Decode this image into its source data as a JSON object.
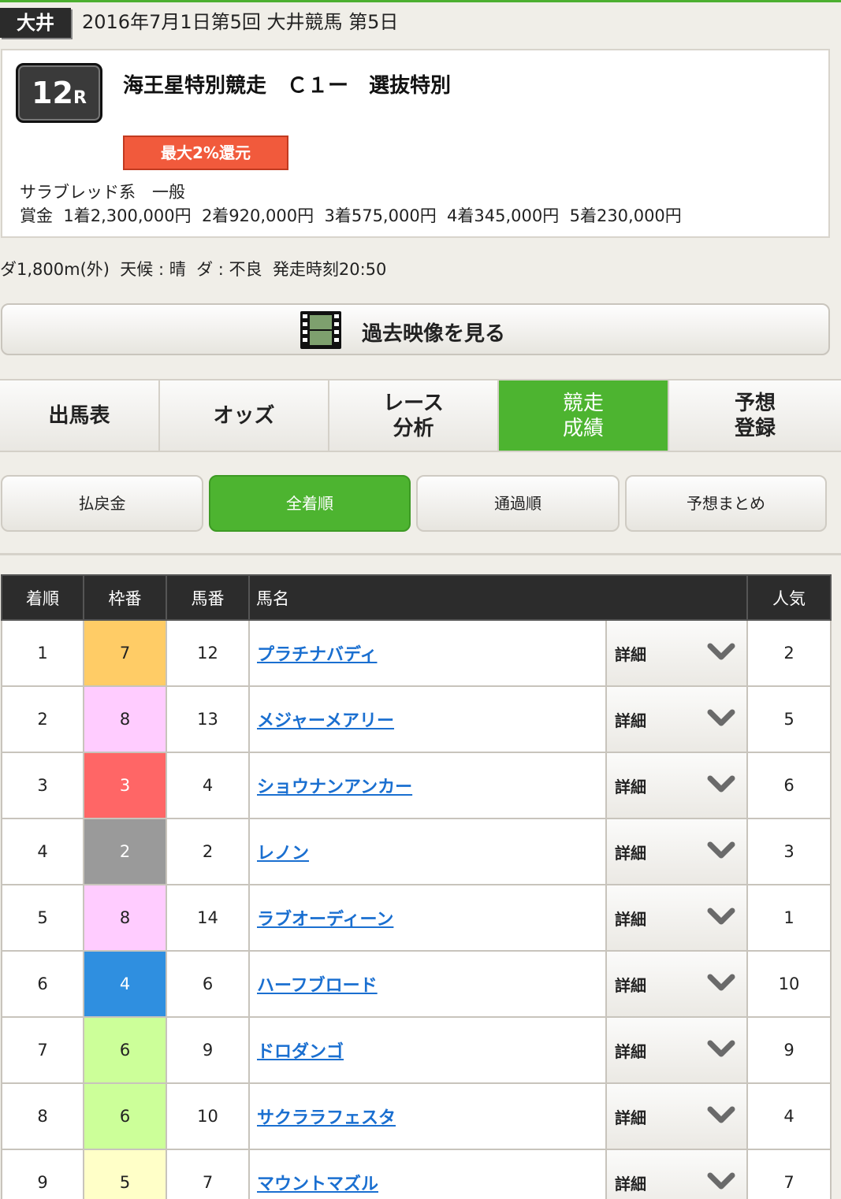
{
  "header": {
    "venue": "大井",
    "meeting": "2016年7月1日第5回 大井競馬 第5日"
  },
  "race": {
    "number": "12",
    "suffix": "R",
    "title": "海王星特別競走　Ｃ１ー　選抜特別",
    "rebate": "最大2%還元",
    "breed": "サラブレッド系　一般",
    "prize": "賞金  1着2,300,000円  2着920,000円  3着575,000円  4着345,000円  5着230,000円"
  },
  "conditions": "ダ1,800m(外)  天候 : 晴  ダ : 不良  発走時刻20:50",
  "video_button": "過去映像を見る",
  "tabs": [
    {
      "line1": "出馬表",
      "line2": ""
    },
    {
      "line1": "オッズ",
      "line2": ""
    },
    {
      "line1": "レース",
      "line2": "分析"
    },
    {
      "line1": "競走",
      "line2": "成績"
    },
    {
      "line1": "予想",
      "line2": "登録"
    }
  ],
  "subtabs": [
    "払戻金",
    "全着順",
    "通過順",
    "予想まとめ"
  ],
  "table": {
    "headers": {
      "rank": "着順",
      "frame": "枠番",
      "horse_no": "馬番",
      "name": "馬名",
      "popularity": "人気"
    },
    "detail_label": "詳細",
    "rows": [
      {
        "rank": "1",
        "frame": "7",
        "horse_no": "12",
        "name": "プラチナバディ",
        "popularity": "2"
      },
      {
        "rank": "2",
        "frame": "8",
        "horse_no": "13",
        "name": "メジャーメアリー",
        "popularity": "5"
      },
      {
        "rank": "3",
        "frame": "3",
        "horse_no": "4",
        "name": "ショウナンアンカー",
        "popularity": "6"
      },
      {
        "rank": "4",
        "frame": "2",
        "horse_no": "2",
        "name": "レノン",
        "popularity": "3"
      },
      {
        "rank": "5",
        "frame": "8",
        "horse_no": "14",
        "name": "ラブオーディーン",
        "popularity": "1"
      },
      {
        "rank": "6",
        "frame": "4",
        "horse_no": "6",
        "name": "ハーフブロード",
        "popularity": "10"
      },
      {
        "rank": "7",
        "frame": "6",
        "horse_no": "9",
        "name": "ドロダンゴ",
        "popularity": "9"
      },
      {
        "rank": "8",
        "frame": "6",
        "horse_no": "10",
        "name": "サクララフェスタ",
        "popularity": "4"
      },
      {
        "rank": "9",
        "frame": "5",
        "horse_no": "7",
        "name": "マウントマズル",
        "popularity": "7"
      }
    ]
  },
  "frame_colors": {
    "2": {
      "bg": "#9a9a9a",
      "fg": "#ffffff"
    },
    "3": {
      "bg": "#ff6666",
      "fg": "#ffffff"
    },
    "4": {
      "bg": "#2f8fe0",
      "fg": "#ffffff"
    },
    "5": {
      "bg": "#ffffc8",
      "fg": "#222222"
    },
    "6": {
      "bg": "#ccff99",
      "fg": "#222222"
    },
    "7": {
      "bg": "#ffcc66",
      "fg": "#222222"
    },
    "8": {
      "bg": "#ffccff",
      "fg": "#222222"
    }
  },
  "colors": {
    "accent_green": "#4db430",
    "link_blue": "#1a6fd0",
    "rebate_red": "#f15a3c"
  }
}
